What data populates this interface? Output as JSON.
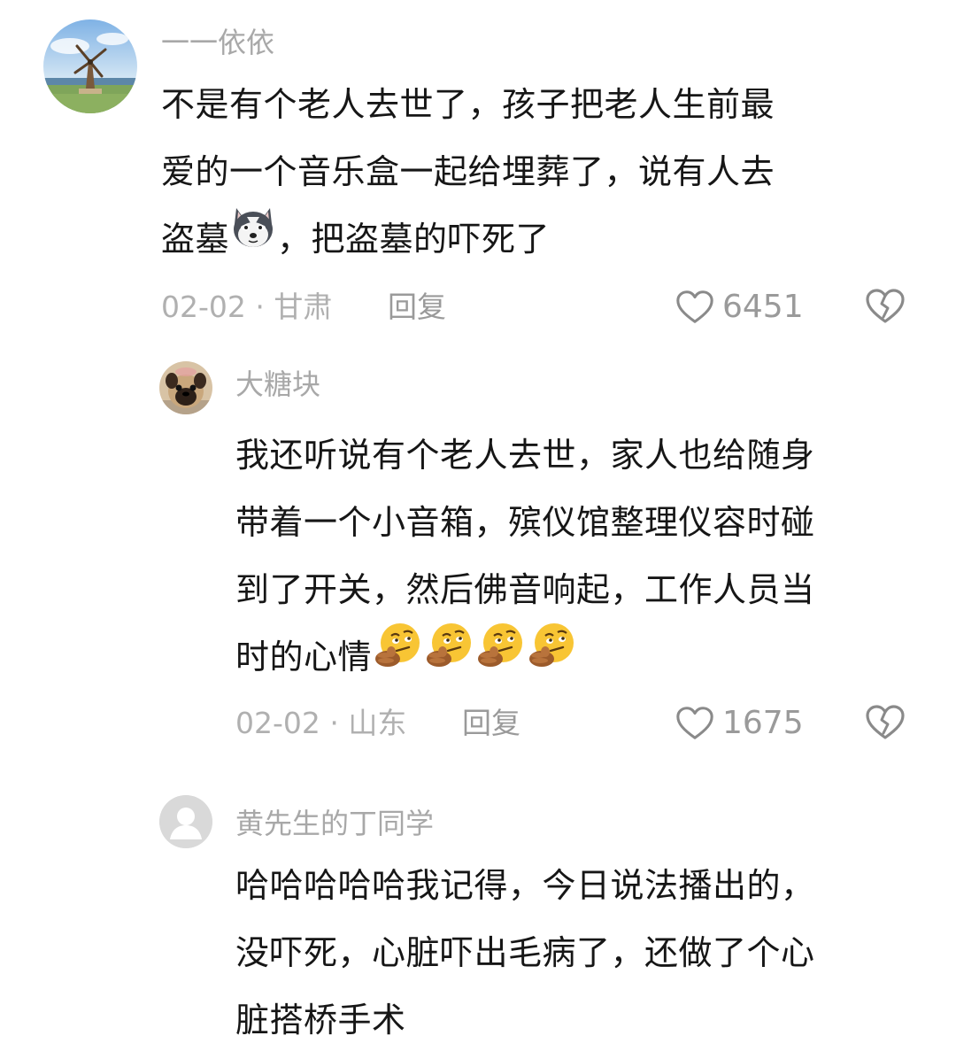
{
  "comments": [
    {
      "username": "一一依依",
      "lines": [
        "不是有个老人去世了，孩子把老人生前最",
        "爱的一个音乐盒一起给埋葬了，说有人去",
        "盗墓",
        "，把盗墓的吓死了"
      ],
      "meta": "02-02 · 甘肃",
      "reply_label": "回复",
      "likes": "6451"
    },
    {
      "username": "大糖块",
      "lines": [
        "我还听说有个老人去世，家人也给随身",
        "带着一个小音箱，殡仪馆整理仪容时碰",
        "到了开关，然后佛音响起，工作人员当",
        "时的心情"
      ],
      "meta": "02-02 · 山东",
      "reply_label": "回复",
      "likes": "1675"
    },
    {
      "username": "黄先生的丁同学",
      "lines": [
        "哈哈哈哈哈我记得，今日说法播出的，",
        "没吓死，心脏吓出毛病了，还做了个心",
        "脏搭桥手术"
      ]
    }
  ],
  "icons": {
    "like": "heart-outline-icon",
    "dislike": "broken-heart-icon",
    "emoji_1": "husky-dog-emoji",
    "emoji_2": "thinking-face-emoji"
  }
}
